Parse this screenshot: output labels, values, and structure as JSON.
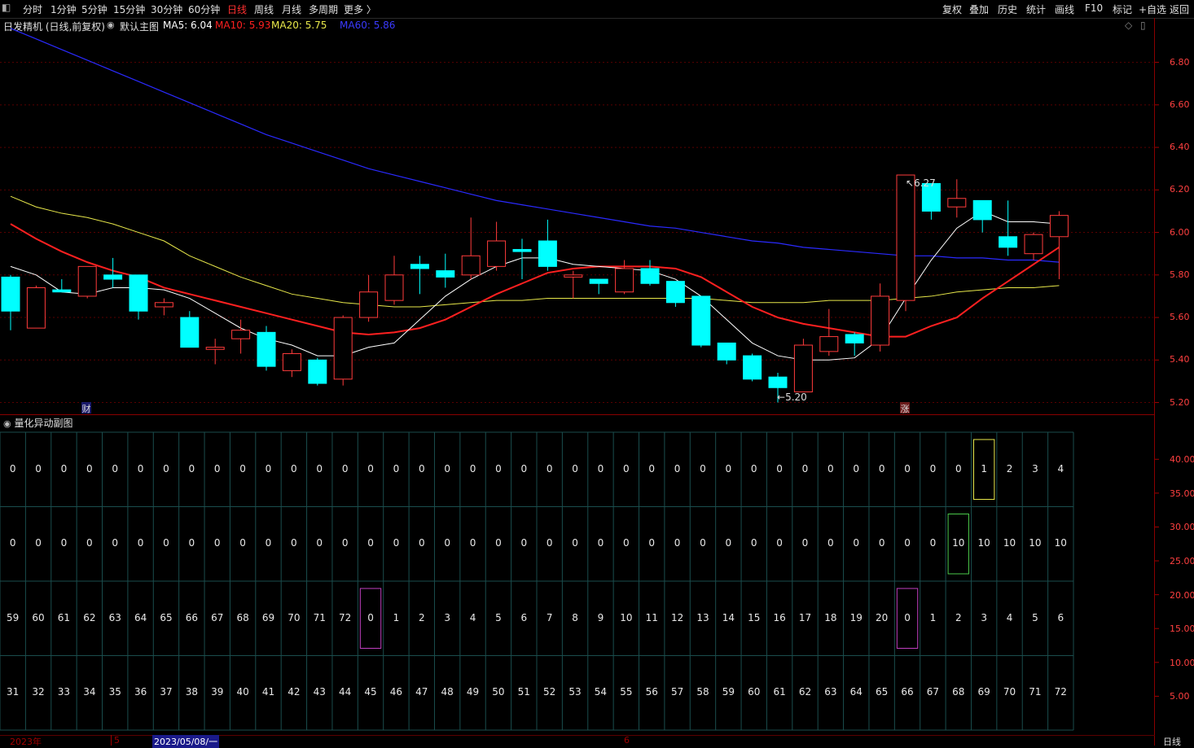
{
  "toolbar": {
    "periods": [
      "分时",
      "1分钟",
      "5分钟",
      "15分钟",
      "30分钟",
      "60分钟",
      "日线",
      "周线",
      "月线",
      "多周期",
      "更多 〉"
    ],
    "active_period": "日线",
    "actions": [
      "复权",
      "叠加",
      "历史",
      "统计",
      "画线",
      "F10",
      "标记",
      "+自选",
      "返回"
    ]
  },
  "info": {
    "stock": "日发精机 (日线,前复权)",
    "template": "默认主图",
    "ma5": "MA5: 6.04",
    "ma10": "MA10: 5.93",
    "ma20": "MA20: 5.75",
    "ma60": "MA60: 5.86"
  },
  "colors": {
    "up": "#ff3b3b",
    "down": "#00ffff",
    "ma5": "#ffffff",
    "ma10": "#ff2020",
    "ma20": "#e8e84a",
    "ma60": "#2a2aff",
    "axis": "#ff4040",
    "grid_cell": "#1a4d4d"
  },
  "annotations": {
    "high": "6.27",
    "low": "5.20",
    "cai_marker": "财",
    "zhang_marker": "涨"
  },
  "sub_chart": {
    "title": "量化异动副图",
    "rows": [
      [
        0,
        0,
        0,
        0,
        0,
        0,
        0,
        0,
        0,
        0,
        0,
        0,
        0,
        0,
        0,
        0,
        0,
        0,
        0,
        0,
        0,
        0,
        0,
        0,
        0,
        0,
        0,
        0,
        0,
        0,
        0,
        0,
        0,
        0,
        0,
        0,
        0,
        0,
        1,
        2,
        3,
        4
      ],
      [
        0,
        0,
        0,
        0,
        0,
        0,
        0,
        0,
        0,
        0,
        0,
        0,
        0,
        0,
        0,
        0,
        0,
        0,
        0,
        0,
        0,
        0,
        0,
        0,
        0,
        0,
        0,
        0,
        0,
        0,
        0,
        0,
        0,
        0,
        0,
        0,
        0,
        10,
        10,
        10,
        10,
        10
      ],
      [
        59,
        60,
        61,
        62,
        63,
        64,
        65,
        66,
        67,
        68,
        69,
        70,
        71,
        72,
        0,
        1,
        2,
        3,
        4,
        5,
        6,
        7,
        8,
        9,
        10,
        11,
        12,
        13,
        14,
        15,
        16,
        17,
        18,
        19,
        20,
        0,
        1,
        2,
        3,
        4,
        5,
        6
      ],
      [
        31,
        32,
        33,
        34,
        35,
        36,
        37,
        38,
        39,
        40,
        41,
        42,
        43,
        44,
        45,
        46,
        47,
        48,
        49,
        50,
        51,
        52,
        53,
        54,
        55,
        56,
        57,
        58,
        59,
        60,
        61,
        62,
        63,
        64,
        65,
        66,
        67,
        68,
        69,
        70,
        71,
        72
      ]
    ],
    "highlight_boxes": [
      {
        "row": 0,
        "col": 38,
        "color": "#e8e84a"
      },
      {
        "row": 1,
        "col": 37,
        "color": "#4ac84a"
      },
      {
        "row": 2,
        "col": 14,
        "color": "#c040c0"
      },
      {
        "row": 2,
        "col": 35,
        "color": "#c040c0"
      }
    ],
    "y_labels": [
      "40.00",
      "35.00",
      "30.00",
      "25.00",
      "20.00",
      "15.00",
      "10.00",
      "5.00"
    ]
  },
  "main_y_labels": [
    "6.80",
    "6.60",
    "6.40",
    "6.20",
    "6.00",
    "5.80",
    "5.60",
    "5.40",
    "5.20"
  ],
  "bottom": {
    "year": "2023年",
    "month5": "5",
    "cursor_date": "2023/05/08/一",
    "month6": "6",
    "period_label": "日线"
  },
  "chart_data": {
    "type": "candlestick",
    "ylim": [
      5.16,
      6.94
    ],
    "candles": [
      {
        "o": 5.79,
        "c": 5.63,
        "h": 5.8,
        "l": 5.54
      },
      {
        "o": 5.55,
        "c": 5.74,
        "h": 5.75,
        "l": 5.55
      },
      {
        "o": 5.73,
        "c": 5.72,
        "h": 5.78,
        "l": 5.72
      },
      {
        "o": 5.7,
        "c": 5.84,
        "h": 5.84,
        "l": 5.69
      },
      {
        "o": 5.8,
        "c": 5.78,
        "h": 5.88,
        "l": 5.74
      },
      {
        "o": 5.8,
        "c": 5.63,
        "h": 5.8,
        "l": 5.59
      },
      {
        "o": 5.65,
        "c": 5.67,
        "h": 5.69,
        "l": 5.61
      },
      {
        "o": 5.6,
        "c": 5.46,
        "h": 5.63,
        "l": 5.46
      },
      {
        "o": 5.45,
        "c": 5.46,
        "h": 5.5,
        "l": 5.38
      },
      {
        "o": 5.5,
        "c": 5.54,
        "h": 5.59,
        "l": 5.43
      },
      {
        "o": 5.53,
        "c": 5.37,
        "h": 5.56,
        "l": 5.35
      },
      {
        "o": 5.35,
        "c": 5.43,
        "h": 5.45,
        "l": 5.32
      },
      {
        "o": 5.4,
        "c": 5.29,
        "h": 5.41,
        "l": 5.28
      },
      {
        "o": 5.31,
        "c": 5.6,
        "h": 5.61,
        "l": 5.28
      },
      {
        "o": 5.6,
        "c": 5.72,
        "h": 5.8,
        "l": 5.58
      },
      {
        "o": 5.68,
        "c": 5.8,
        "h": 5.89,
        "l": 5.66
      },
      {
        "o": 5.85,
        "c": 5.83,
        "h": 5.89,
        "l": 5.71
      },
      {
        "o": 5.82,
        "c": 5.79,
        "h": 5.9,
        "l": 5.74
      },
      {
        "o": 5.8,
        "c": 5.89,
        "h": 6.07,
        "l": 5.78
      },
      {
        "o": 5.84,
        "c": 5.96,
        "h": 6.05,
        "l": 5.82
      },
      {
        "o": 5.92,
        "c": 5.91,
        "h": 5.97,
        "l": 5.78
      },
      {
        "o": 5.96,
        "c": 5.84,
        "h": 6.06,
        "l": 5.82
      },
      {
        "o": 5.79,
        "c": 5.8,
        "h": 5.82,
        "l": 5.69
      },
      {
        "o": 5.78,
        "c": 5.76,
        "h": 5.78,
        "l": 5.71
      },
      {
        "o": 5.72,
        "c": 5.83,
        "h": 5.87,
        "l": 5.71
      },
      {
        "o": 5.83,
        "c": 5.76,
        "h": 5.87,
        "l": 5.75
      },
      {
        "o": 5.77,
        "c": 5.67,
        "h": 5.77,
        "l": 5.65
      },
      {
        "o": 5.7,
        "c": 5.47,
        "h": 5.7,
        "l": 5.46
      },
      {
        "o": 5.48,
        "c": 5.4,
        "h": 5.48,
        "l": 5.38
      },
      {
        "o": 5.42,
        "c": 5.31,
        "h": 5.43,
        "l": 5.3
      },
      {
        "o": 5.32,
        "c": 5.27,
        "h": 5.34,
        "l": 5.2
      },
      {
        "o": 5.25,
        "c": 5.47,
        "h": 5.5,
        "l": 5.25
      },
      {
        "o": 5.44,
        "c": 5.51,
        "h": 5.64,
        "l": 5.42
      },
      {
        "o": 5.52,
        "c": 5.48,
        "h": 5.53,
        "l": 5.42
      },
      {
        "o": 5.47,
        "c": 5.7,
        "h": 5.76,
        "l": 5.44
      },
      {
        "o": 5.68,
        "c": 6.27,
        "h": 6.27,
        "l": 5.63
      },
      {
        "o": 6.23,
        "c": 6.1,
        "h": 6.23,
        "l": 6.06
      },
      {
        "o": 6.12,
        "c": 6.16,
        "h": 6.25,
        "l": 6.07
      },
      {
        "o": 6.15,
        "c": 6.06,
        "h": 6.15,
        "l": 6.0
      },
      {
        "o": 5.98,
        "c": 5.93,
        "h": 6.15,
        "l": 5.89
      },
      {
        "o": 5.9,
        "c": 5.99,
        "h": 6.0,
        "l": 5.87
      },
      {
        "o": 5.98,
        "c": 6.08,
        "h": 6.1,
        "l": 5.78
      }
    ],
    "ma5": [
      5.84,
      5.8,
      5.72,
      5.71,
      5.74,
      5.74,
      5.73,
      5.69,
      5.62,
      5.55,
      5.5,
      5.47,
      5.42,
      5.42,
      5.46,
      5.48,
      5.59,
      5.7,
      5.78,
      5.84,
      5.88,
      5.88,
      5.85,
      5.84,
      5.83,
      5.82,
      5.78,
      5.7,
      5.59,
      5.48,
      5.42,
      5.4,
      5.4,
      5.41,
      5.5,
      5.69,
      5.87,
      6.02,
      6.1,
      6.05,
      6.05,
      6.04
    ],
    "ma10": [
      6.04,
      5.97,
      5.91,
      5.86,
      5.82,
      5.79,
      5.74,
      5.71,
      5.68,
      5.65,
      5.62,
      5.59,
      5.56,
      5.53,
      5.52,
      5.53,
      5.55,
      5.59,
      5.65,
      5.71,
      5.76,
      5.81,
      5.83,
      5.84,
      5.84,
      5.84,
      5.83,
      5.79,
      5.72,
      5.65,
      5.6,
      5.57,
      5.55,
      5.53,
      5.51,
      5.51,
      5.56,
      5.6,
      5.69,
      5.77,
      5.85,
      5.93
    ],
    "ma20": [
      6.17,
      6.12,
      6.09,
      6.07,
      6.04,
      6.0,
      5.96,
      5.89,
      5.84,
      5.79,
      5.75,
      5.71,
      5.69,
      5.67,
      5.66,
      5.65,
      5.65,
      5.66,
      5.67,
      5.68,
      5.68,
      5.69,
      5.69,
      5.69,
      5.69,
      5.69,
      5.69,
      5.69,
      5.68,
      5.67,
      5.67,
      5.67,
      5.68,
      5.68,
      5.68,
      5.69,
      5.7,
      5.72,
      5.73,
      5.74,
      5.74,
      5.75
    ],
    "ma60": [
      6.96,
      6.91,
      6.86,
      6.81,
      6.76,
      6.71,
      6.66,
      6.61,
      6.56,
      6.51,
      6.46,
      6.42,
      6.38,
      6.34,
      6.3,
      6.27,
      6.24,
      6.21,
      6.18,
      6.15,
      6.13,
      6.11,
      6.09,
      6.07,
      6.05,
      6.03,
      6.02,
      6.0,
      5.98,
      5.96,
      5.95,
      5.93,
      5.92,
      5.91,
      5.9,
      5.89,
      5.89,
      5.88,
      5.88,
      5.87,
      5.87,
      5.86
    ]
  }
}
